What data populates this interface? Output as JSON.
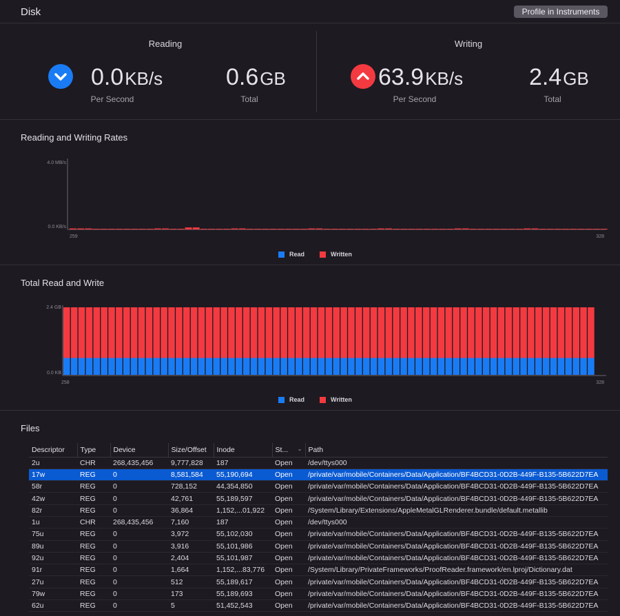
{
  "header": {
    "title": "Disk",
    "profile_button": "Profile in Instruments"
  },
  "reading": {
    "title": "Reading",
    "per_second_value": "0.0",
    "per_second_unit": "KB/s",
    "per_second_label": "Per Second",
    "total_value": "0.6",
    "total_unit": "GB",
    "total_label": "Total",
    "icon": "chevron-down-icon",
    "color": "#1a7cf5"
  },
  "writing": {
    "title": "Writing",
    "per_second_value": "63.9",
    "per_second_unit": "KB/s",
    "per_second_label": "Per Second",
    "total_value": "2.4",
    "total_unit": "GB",
    "total_label": "Total",
    "icon": "chevron-up-icon",
    "color": "#f33a41"
  },
  "chart_data": [
    {
      "type": "bar",
      "title": "Reading and Writing Rates",
      "y_tick_labels": [
        "4.0 MB/s",
        "0.0 KB/s"
      ],
      "x_tick_labels": [
        "259",
        "328"
      ],
      "ylim": [
        0,
        4.0
      ],
      "x": [
        259,
        328
      ],
      "grid": false,
      "legend_position": "bottom",
      "series": [
        {
          "name": "Read",
          "color": "#1a7cf5",
          "values": []
        },
        {
          "name": "Written",
          "color": "#f33a41",
          "values": [
            0.06,
            0.06,
            0.06,
            0.02,
            0.02,
            0.02,
            0.02,
            0.02,
            0.02,
            0.02,
            0.02,
            0.06,
            0.06,
            0.02,
            0.02,
            0.12,
            0.12,
            0.02,
            0.02,
            0.02,
            0.02,
            0.06,
            0.06,
            0.02,
            0.02,
            0.02,
            0.02,
            0.02,
            0.02,
            0.02,
            0.02,
            0.06,
            0.06,
            0.02,
            0.02,
            0.02,
            0.02,
            0.02,
            0.02,
            0.02,
            0.06,
            0.06,
            0.03,
            0.03,
            0.03,
            0.03,
            0.02,
            0.02,
            0.02,
            0.02,
            0.06,
            0.06,
            0.03,
            0.03,
            0.02,
            0.02,
            0.02,
            0.02,
            0.02,
            0.06,
            0.06,
            0.02,
            0.02,
            0.02,
            0.02,
            0.02,
            0.02,
            0.02,
            0.02,
            0.02
          ]
        }
      ]
    },
    {
      "type": "bar",
      "title": "Total Read and Write",
      "y_tick_labels": [
        "2.4 GB",
        "0.0 KB"
      ],
      "x_tick_labels": [
        "258",
        "328"
      ],
      "ylim": [
        0,
        2.4
      ],
      "x": [
        258,
        328
      ],
      "stacked": true,
      "grid": false,
      "legend_position": "bottom",
      "bar_count": 71,
      "series": [
        {
          "name": "Read",
          "color": "#1a7cf5",
          "value_each": 0.6
        },
        {
          "name": "Written",
          "color": "#f33a41",
          "value_each": 1.8
        }
      ]
    }
  ],
  "files": {
    "title": "Files",
    "columns": [
      "Descriptor",
      "Type",
      "Device",
      "Size/Offset",
      "Inode",
      "St...",
      "Path"
    ],
    "selected_row": 1,
    "rows": [
      [
        "2u",
        "CHR",
        "268,435,456",
        "9,777,828",
        "187",
        "Open",
        "/dev/ttys000"
      ],
      [
        "17w",
        "REG",
        "0",
        "8,581,584",
        "55,190,694",
        "Open",
        "/private/var/mobile/Containers/Data/Application/BF4BCD31-0D2B-449F-B135-5B622D7EA"
      ],
      [
        "58r",
        "REG",
        "0",
        "728,152",
        "44,354,850",
        "Open",
        "/private/var/mobile/Containers/Data/Application/BF4BCD31-0D2B-449F-B135-5B622D7EA"
      ],
      [
        "42w",
        "REG",
        "0",
        "42,761",
        "55,189,597",
        "Open",
        "/private/var/mobile/Containers/Data/Application/BF4BCD31-0D2B-449F-B135-5B622D7EA"
      ],
      [
        "82r",
        "REG",
        "0",
        "36,864",
        "1,152,...01,922",
        "Open",
        "/System/Library/Extensions/AppleMetalGLRenderer.bundle/default.metallib"
      ],
      [
        "1u",
        "CHR",
        "268,435,456",
        "7,160",
        "187",
        "Open",
        "/dev/ttys000"
      ],
      [
        "75u",
        "REG",
        "0",
        "3,972",
        "55,102,030",
        "Open",
        "/private/var/mobile/Containers/Data/Application/BF4BCD31-0D2B-449F-B135-5B622D7EA"
      ],
      [
        "89u",
        "REG",
        "0",
        "3,916",
        "55,101,986",
        "Open",
        "/private/var/mobile/Containers/Data/Application/BF4BCD31-0D2B-449F-B135-5B622D7EA"
      ],
      [
        "92u",
        "REG",
        "0",
        "2,404",
        "55,101,987",
        "Open",
        "/private/var/mobile/Containers/Data/Application/BF4BCD31-0D2B-449F-B135-5B622D7EA"
      ],
      [
        "91r",
        "REG",
        "0",
        "1,664",
        "1,152,...83,776",
        "Open",
        "/System/Library/PrivateFrameworks/ProofReader.framework/en.lproj/Dictionary.dat"
      ],
      [
        "27u",
        "REG",
        "0",
        "512",
        "55,189,617",
        "Open",
        "/private/var/mobile/Containers/Data/Application/BF4BCD31-0D2B-449F-B135-5B622D7EA"
      ],
      [
        "79w",
        "REG",
        "0",
        "173",
        "55,189,693",
        "Open",
        "/private/var/mobile/Containers/Data/Application/BF4BCD31-0D2B-449F-B135-5B622D7EA"
      ],
      [
        "62u",
        "REG",
        "0",
        "5",
        "51,452,543",
        "Open",
        "/private/var/mobile/Containers/Data/Application/BF4BCD31-0D2B-449F-B135-5B622D7EA"
      ]
    ]
  }
}
